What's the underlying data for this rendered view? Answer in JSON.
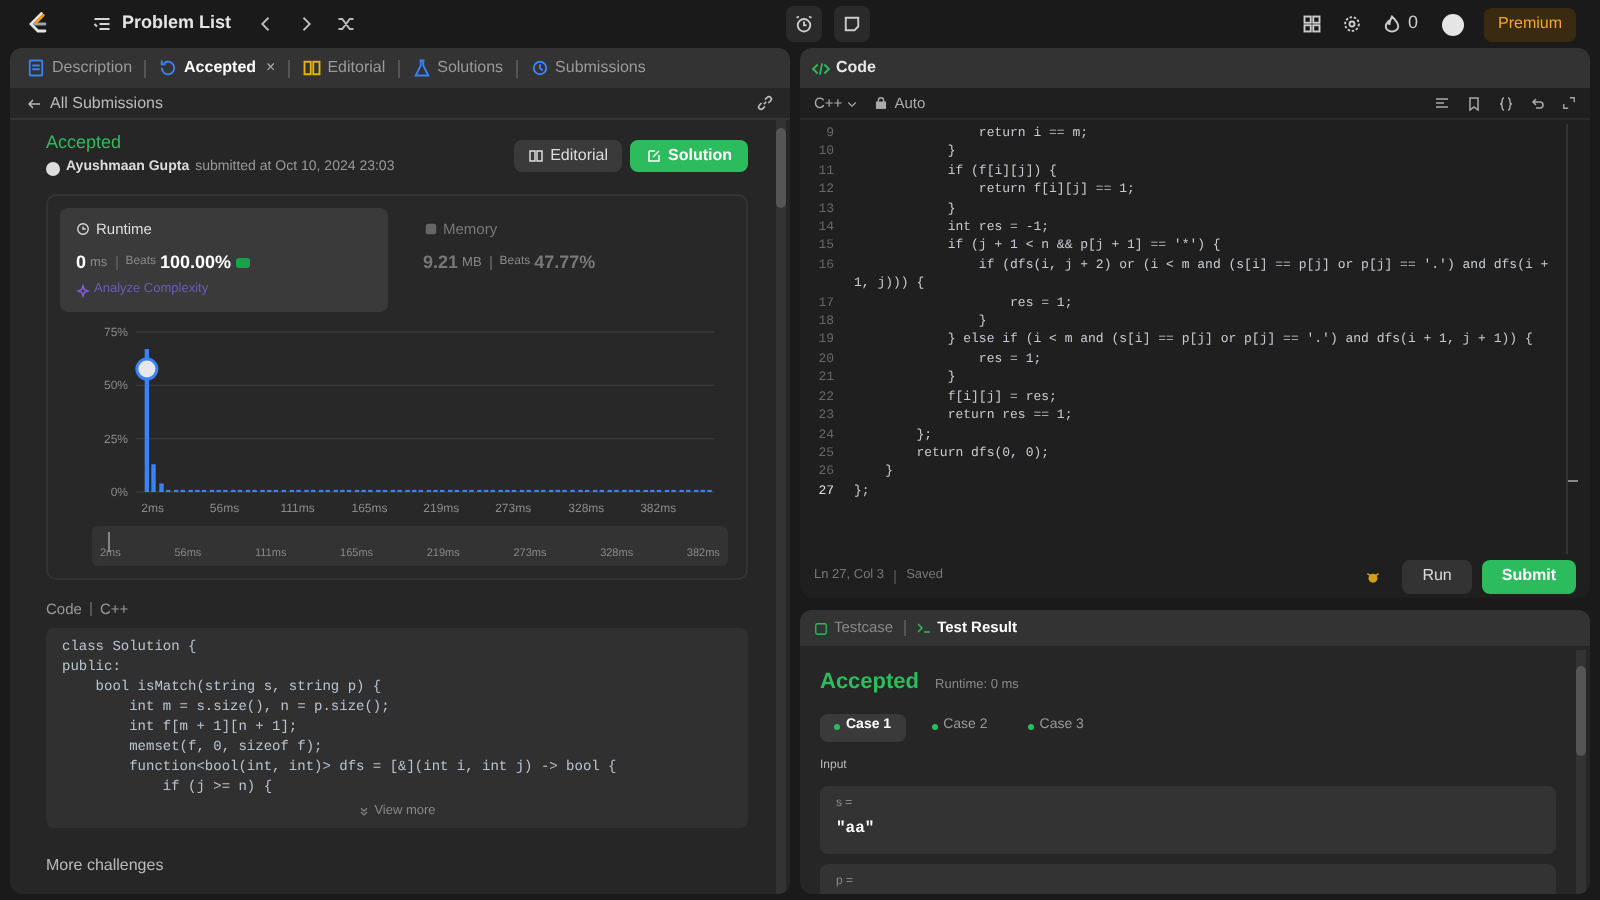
{
  "topbar": {
    "title": "Problem List",
    "streak": "0",
    "premium": "Premium"
  },
  "left_tabs": [
    {
      "label": "Description",
      "selected": false,
      "color": "#3b82f6"
    },
    {
      "label": "Accepted",
      "selected": true,
      "color": "#3b82f6",
      "close": "×"
    },
    {
      "label": "Editorial",
      "selected": false,
      "color": "#eab308"
    },
    {
      "label": "Solutions",
      "selected": false,
      "color": "#3b82f6"
    },
    {
      "label": "Submissions",
      "selected": false,
      "color": "#3b82f6"
    }
  ],
  "back_link": "All Submissions",
  "submission": {
    "status": "Accepted",
    "user": "Ayushmaan Gupta",
    "submitted": "submitted at Oct 10, 2024 23:03",
    "editorial_button": "Editorial",
    "solution_button": "Solution"
  },
  "stats": [
    {
      "title": "Runtime",
      "value": "0",
      "unit": "ms",
      "beats_label": "Beats",
      "beats": "100.00%",
      "selected": true,
      "link": "Analyze Complexity"
    },
    {
      "title": "Memory",
      "value": "9.21",
      "unit": "MB",
      "beats_label": "Beats",
      "beats": "47.77%",
      "selected": false
    }
  ],
  "chart": {
    "chart_data": {
      "type": "bar",
      "xlim": [
        0,
        430
      ],
      "ylim": [
        0,
        75
      ],
      "yticks": [
        {
          "value": 0,
          "label": "0%"
        },
        {
          "value": 25,
          "label": "25%"
        },
        {
          "value": 50,
          "label": "50%"
        },
        {
          "value": 75,
          "label": "75%"
        }
      ],
      "xticks": [
        {
          "value": 2,
          "label": "2ms"
        },
        {
          "value": 56,
          "label": "56ms"
        },
        {
          "value": 111,
          "label": "111ms"
        },
        {
          "value": 165,
          "label": "165ms"
        },
        {
          "value": 219,
          "label": "219ms"
        },
        {
          "value": 273,
          "label": "273ms"
        },
        {
          "value": 328,
          "label": "328ms"
        },
        {
          "value": 382,
          "label": "382ms"
        }
      ],
      "x": [
        2,
        7,
        13,
        18,
        24,
        29,
        35,
        40,
        45,
        51,
        56,
        61,
        67,
        72,
        78,
        83,
        89,
        94,
        99,
        105,
        111,
        116,
        122,
        127,
        133,
        138,
        144,
        149,
        154,
        160,
        165,
        170,
        176,
        181,
        187,
        192,
        198,
        203,
        208,
        214,
        219,
        224,
        230,
        235,
        241,
        246,
        252,
        257,
        262,
        268,
        273,
        278,
        284,
        289,
        295,
        300,
        306,
        311,
        316,
        322,
        328,
        333,
        339,
        344,
        350,
        355,
        361,
        366,
        371,
        377,
        382,
        387,
        393,
        398,
        404,
        409,
        415,
        420,
        425
      ],
      "series": [
        {
          "color": "#3b82f6",
          "values": [
            67,
            13,
            4,
            1,
            1,
            1,
            1,
            1,
            1,
            1,
            1,
            1,
            1,
            1,
            1,
            1,
            1,
            1,
            1,
            1,
            1,
            1,
            1,
            1,
            1,
            1,
            1,
            1,
            1,
            1,
            1,
            1,
            1,
            1,
            1,
            1,
            1,
            1,
            1,
            1,
            1,
            1,
            1,
            1,
            1,
            1,
            1,
            1,
            1,
            1,
            1,
            1,
            1,
            1,
            1,
            1,
            1,
            1,
            1,
            1,
            1,
            1,
            1,
            1,
            1,
            1,
            1,
            1,
            1,
            1,
            1,
            1,
            1,
            1,
            1,
            1,
            1,
            1,
            1
          ]
        }
      ]
    },
    "navigator_labels": [
      "2ms",
      "56ms",
      "111ms",
      "165ms",
      "219ms",
      "273ms",
      "328ms",
      "382ms"
    ]
  },
  "code_card": {
    "label": "Code",
    "language": "C++",
    "view_more": "View more",
    "lines": [
      "class Solution {",
      "public:",
      "    bool isMatch(string s, string p) {",
      "        int m = s.size(), n = p.size();",
      "        int f[m + 1][n + 1];",
      "        memset(f, 0, sizeof f);",
      "        function<bool(int, int)> dfs = [&](int i, int j) -> bool {",
      "            if (j >= n) {"
    ]
  },
  "more_challenges": "More challenges",
  "editor": {
    "title": "Code",
    "language": "C++",
    "mode": "Auto",
    "lines": [
      {
        "number": "9",
        "text": "                return i == m;",
        "current": false
      },
      {
        "number": "10",
        "text": "            }",
        "current": false
      },
      {
        "number": "11",
        "text": "            if (f[i][j]) {",
        "current": false
      },
      {
        "number": "12",
        "text": "                return f[i][j] == 1;",
        "current": false
      },
      {
        "number": "13",
        "text": "            }",
        "current": false
      },
      {
        "number": "14",
        "text": "            int res = -1;",
        "current": false
      },
      {
        "number": "15",
        "text": "            if (j + 1 < n && p[j + 1] == '*') {",
        "current": false
      },
      {
        "number": "16",
        "text": "                if (dfs(i, j + 2) or (i < m and (s[i] == p[j] or p[j] == '.') and dfs(i + 1, j))) {",
        "current": false
      },
      {
        "number": "17",
        "text": "                    res = 1;",
        "current": false
      },
      {
        "number": "18",
        "text": "                }",
        "current": false
      },
      {
        "number": "19",
        "text": "            } else if (i < m and (s[i] == p[j] or p[j] == '.') and dfs(i + 1, j + 1)) {",
        "current": false
      },
      {
        "number": "20",
        "text": "                res = 1;",
        "current": false
      },
      {
        "number": "21",
        "text": "            }",
        "current": false
      },
      {
        "number": "22",
        "text": "            f[i][j] = res;",
        "current": false
      },
      {
        "number": "23",
        "text": "            return res == 1;",
        "current": false
      },
      {
        "number": "24",
        "text": "        };",
        "current": false
      },
      {
        "number": "25",
        "text": "        return dfs(0, 0);",
        "current": false
      },
      {
        "number": "26",
        "text": "    }",
        "current": false
      },
      {
        "number": "27",
        "text": "};",
        "current": true
      }
    ],
    "cursor": "Ln 27, Col 3",
    "saved": "Saved",
    "run": "Run",
    "submit": "Submit"
  },
  "result_tabs": [
    {
      "label": "Testcase",
      "selected": false
    },
    {
      "label": "Test Result",
      "selected": true
    }
  ],
  "result": {
    "status": "Accepted",
    "runtime": "Runtime: 0 ms",
    "cases": [
      {
        "label": "Case 1",
        "selected": true
      },
      {
        "label": "Case 2",
        "selected": false
      },
      {
        "label": "Case 3",
        "selected": false
      }
    ],
    "input_label": "Input",
    "inputs": [
      {
        "name": "s =",
        "value": "\"aa\""
      },
      {
        "name": "p ="
      }
    ]
  }
}
